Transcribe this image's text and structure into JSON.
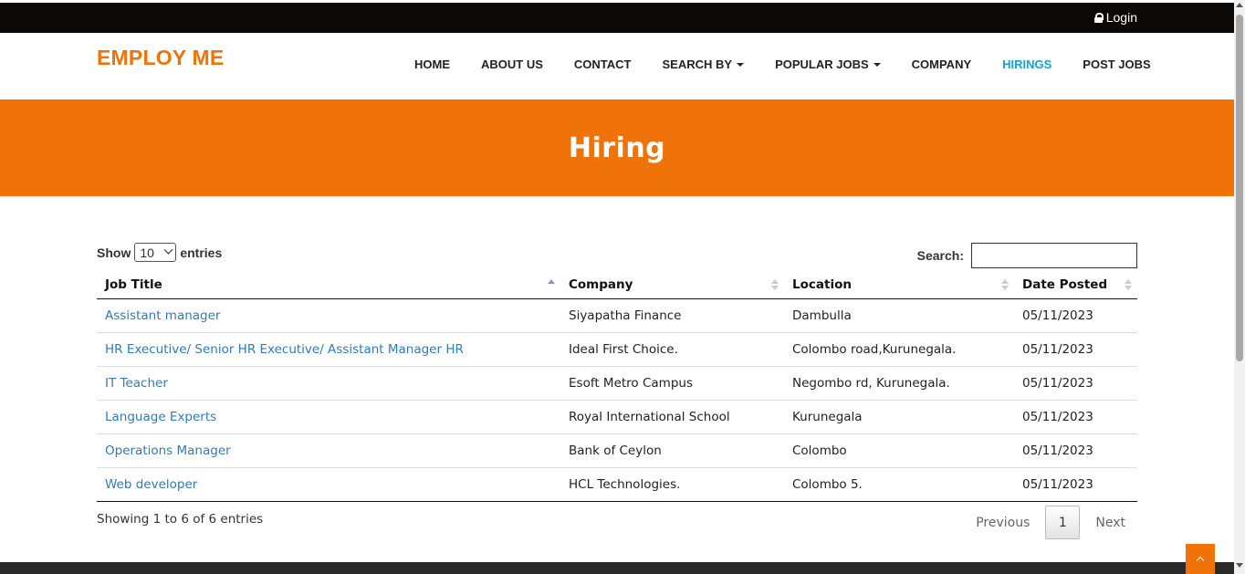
{
  "topbar": {
    "login_label": "Login",
    "login_icon": "lock-icon"
  },
  "nav": {
    "brand": "EMPLOY ME",
    "items": [
      {
        "label": "HOME",
        "dropdown": false,
        "active": false
      },
      {
        "label": "ABOUT US",
        "dropdown": false,
        "active": false
      },
      {
        "label": "CONTACT",
        "dropdown": false,
        "active": false
      },
      {
        "label": "SEARCH BY",
        "dropdown": true,
        "active": false
      },
      {
        "label": "POPULAR JOBS",
        "dropdown": true,
        "active": false
      },
      {
        "label": "COMPANY",
        "dropdown": false,
        "active": false
      },
      {
        "label": "HIRINGS",
        "dropdown": false,
        "active": true
      },
      {
        "label": "POST JOBS",
        "dropdown": false,
        "active": false
      }
    ]
  },
  "hero": {
    "title": "Hiring"
  },
  "table_controls": {
    "show_label": "Show",
    "entries_value": "10",
    "entries_label": "entries",
    "search_label": "Search:",
    "search_value": ""
  },
  "table": {
    "columns": [
      "Job Title",
      "Company",
      "Location",
      "Date Posted"
    ],
    "sorted_column": 0,
    "rows": [
      [
        "Assistant manager",
        "Siyapatha Finance",
        "Dambulla",
        "05/11/2023"
      ],
      [
        "HR Executive/ Senior HR Executive/ Assistant Manager HR",
        "Ideal First Choice.",
        "Colombo road,Kurunegala.",
        "05/11/2023"
      ],
      [
        "IT Teacher",
        "Esoft Metro Campus",
        "Negombo rd, Kurunegala.",
        "05/11/2023"
      ],
      [
        "Language Experts",
        "Royal International School",
        "Kurunegala",
        "05/11/2023"
      ],
      [
        "Operations Manager",
        "Bank of Ceylon",
        "Colombo",
        "05/11/2023"
      ],
      [
        "Web developer",
        "HCL Technologies.",
        "Colombo 5.",
        "05/11/2023"
      ]
    ]
  },
  "pagination": {
    "info": "Showing 1 to 6 of 6 entries",
    "previous": "Previous",
    "current_page": "1",
    "next": "Next"
  },
  "colors": {
    "accent": "#f0730a",
    "active_nav": "#17a2c9",
    "link": "#337ab7",
    "topbar": "#0c0805"
  }
}
